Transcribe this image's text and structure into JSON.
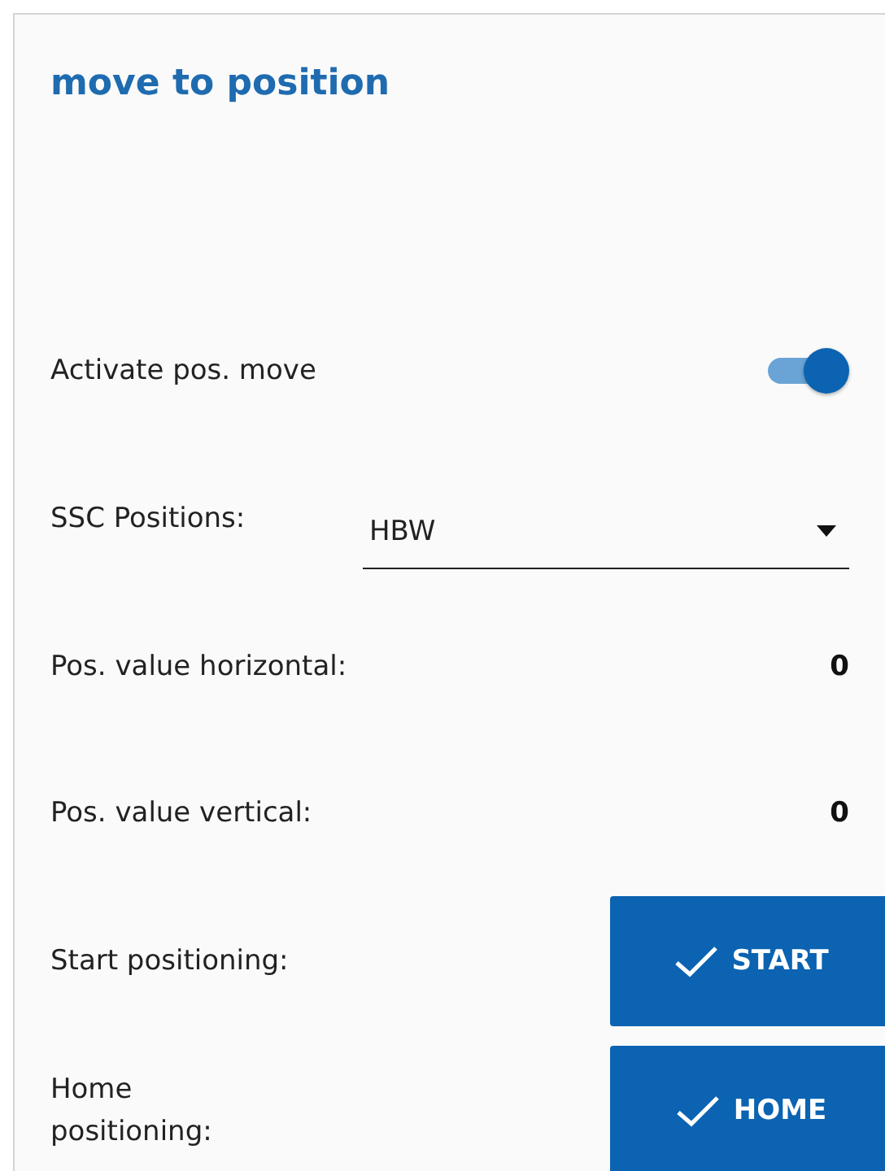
{
  "panel": {
    "title": "move to position"
  },
  "rows": [
    {
      "kind": "toggle",
      "label": "Activate pos. move",
      "on": true
    },
    {
      "kind": "select",
      "label": "SSC Positions:",
      "value": "HBW"
    },
    {
      "kind": "value",
      "label": "Pos. value horizontal:",
      "value": "0"
    },
    {
      "kind": "value",
      "label": "Pos. value vertical:",
      "value": "0"
    },
    {
      "kind": "button",
      "label": "Start positioning:",
      "button": "START"
    },
    {
      "kind": "button",
      "label": "Home\npositioning:",
      "button": "HOME"
    }
  ]
}
